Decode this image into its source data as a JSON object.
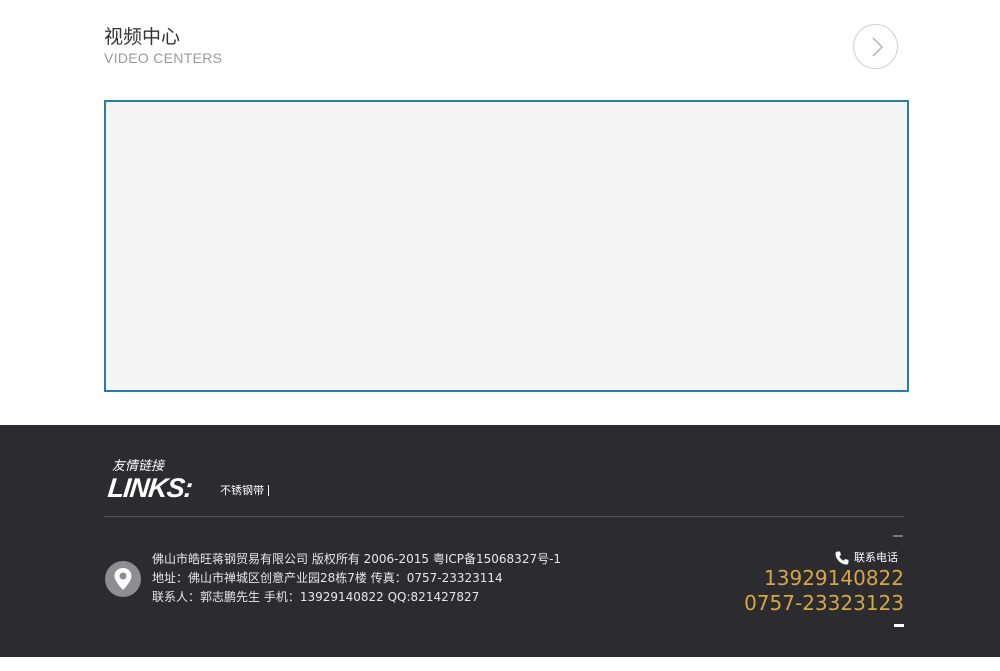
{
  "video_section": {
    "title": "视频中心",
    "subtitle": "VIDEO CENTERS",
    "next_icon": "chevron-right-icon"
  },
  "footer": {
    "links": {
      "title_cn": "友情链接",
      "title_en": "LINKS:",
      "items": [
        "不锈钢带"
      ]
    },
    "company_info": {
      "line1": "佛山市皓旺蒋钢贸易有限公司 版权所有 2006-2015 粤ICP备15068327号-1",
      "line2": "地址：佛山市禅城区创意产业园28栋7楼 传真：0757-23323114",
      "line3": "联系人：郭志鹏先生 手机：13929140822 QQ:821427827",
      "icon": "location-pin-icon"
    },
    "contact": {
      "label": "联系电话",
      "icon": "phone-icon",
      "phone1": "13929140822",
      "phone2": "0757-23323123"
    }
  },
  "colors": {
    "frame_border": "#2a7cad",
    "footer_bg": "#2b2b30",
    "phone_accent": "#d4a843"
  }
}
